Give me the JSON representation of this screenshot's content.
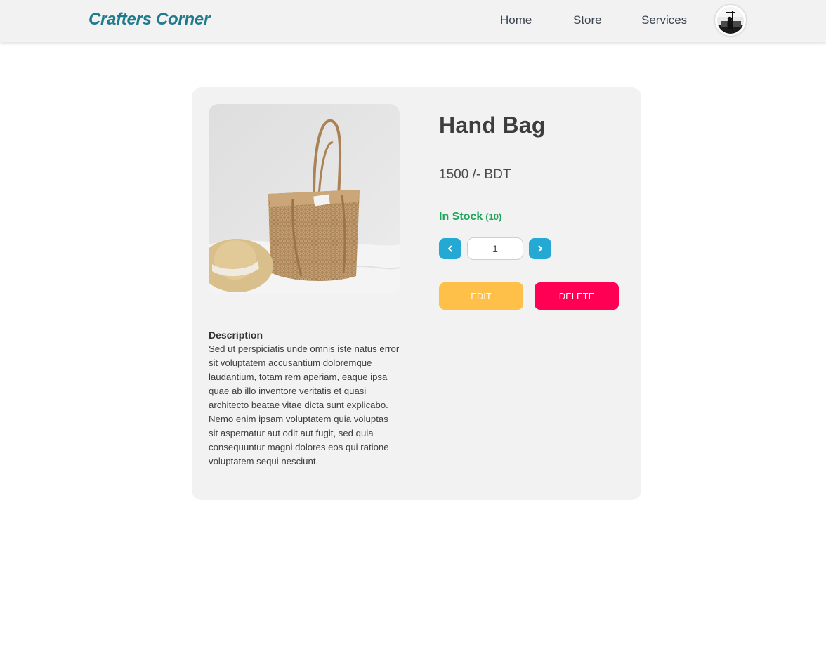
{
  "header": {
    "logo": "Crafters Corner",
    "nav": [
      {
        "label": "Home"
      },
      {
        "label": "Store"
      },
      {
        "label": "Services"
      }
    ]
  },
  "product": {
    "title": "Hand Bag",
    "price": "1500 /- BDT",
    "stock_label": "In Stock",
    "stock_count": "(10)",
    "quantity": "1",
    "edit_label": "EDIT",
    "delete_label": "DELETE",
    "description_title": "Description",
    "description": "Sed ut perspiciatis unde omnis iste natus error sit voluptatem accusantium doloremque laudantium, totam rem aperiam, eaque ipsa quae ab illo inventore veritatis et quasi architecto beatae vitae dicta sunt explicabo. Nemo enim ipsam voluptatem quia voluptas sit aspernatur aut odit aut fugit, sed quia consequuntur magni dolores eos qui ratione voluptatem sequi nesciunt."
  },
  "colors": {
    "brand": "#1f7a8c",
    "in_stock": "#1ca55a",
    "qty_button": "#23a9d4",
    "edit_button": "#ffc04a",
    "delete_button": "#ff0054"
  },
  "icons": {
    "decrement": "chevron-left-icon",
    "increment": "chevron-right-icon"
  }
}
